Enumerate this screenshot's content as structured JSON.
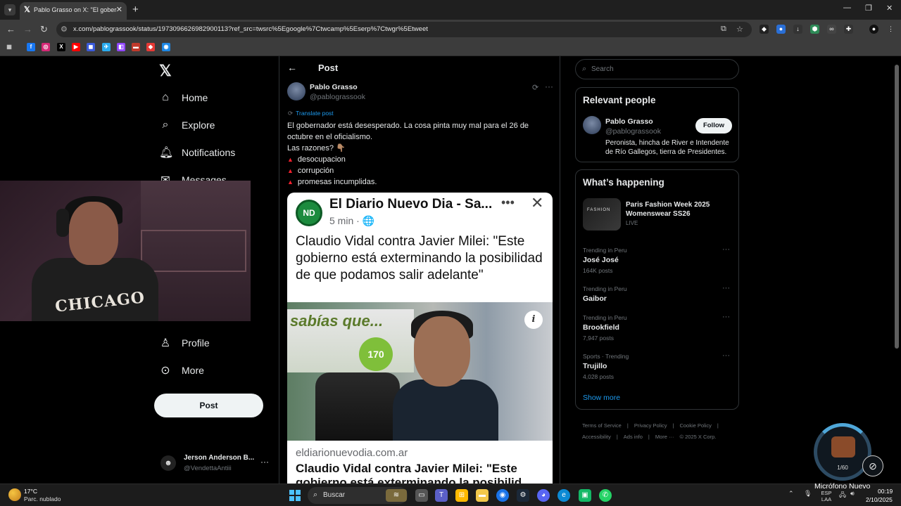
{
  "browser": {
    "tab_title": "Pablo Grasso on X: \"El gobernador...",
    "url": "x.com/pablograssook/status/1973096626982900113?ref_src=twsrc%5Egoogle%7Ctwcamp%5Eserp%7Ctwgr%5Etweet"
  },
  "nav": {
    "items": [
      {
        "label": "Home"
      },
      {
        "label": "Explore"
      },
      {
        "label": "Notifications"
      },
      {
        "label": "Messages"
      },
      {
        "label": "Profile"
      },
      {
        "label": "More"
      }
    ],
    "post_button": "Post"
  },
  "account": {
    "name": "Jerson Anderson B...",
    "handle": "@VendettaAntiii"
  },
  "webcam": {
    "shirt_text": "CHICAGO"
  },
  "post": {
    "header": "Post",
    "author_name": "Pablo Grasso",
    "author_handle": "@pablograssook",
    "translate": "Translate post",
    "line1": "El gobernador está desesperado. La cosa pinta muy mal para el 26 de octubre en el oficialismo.",
    "line2": "Las razones? 👇🏽",
    "bullets": [
      "desocupacion",
      "corrupción",
      "promesas incumplidas."
    ],
    "card": {
      "logo": "ND",
      "source": "El Diario Nuevo Dia - Sa...",
      "time": "5 min · 🌐",
      "headline": "Claudio Vidal contra Javier Milei: \"Este gobierno está exterminando la posibilidad de que podamos salir adelante\"",
      "billboard": "sabías que...",
      "badge": "170",
      "domain": "eldiarionuevodia.com.ar",
      "headline2": "Claudio Vidal contra Javier Milei: \"Este gobierno está exterminando la posibilid..."
    }
  },
  "sidebar": {
    "search_placeholder": "Search",
    "relevant_title": "Relevant people",
    "rp_name": "Pablo Grasso",
    "rp_handle": "@pablograssook",
    "follow": "Follow",
    "rp_bio": "Peronista, hincha de River e Intendente de Río Gallegos, tierra de Presidentes.",
    "happening_title": "What’s happening",
    "event_thumb": "FASHION",
    "event_title": "Paris Fashion Week 2025 Womenswear SS26",
    "event_live": "LIVE",
    "trends": [
      {
        "context": "Trending in Peru",
        "name": "José José",
        "count": "164K posts"
      },
      {
        "context": "Trending in Peru",
        "name": "Gaibor",
        "count": ""
      },
      {
        "context": "Trending in Peru",
        "name": "Brookfield",
        "count": "7,947 posts"
      },
      {
        "context": "Sports · Trending",
        "name": "Trujillo",
        "count": "4,028 posts"
      }
    ],
    "show_more": "Show more",
    "footer": [
      "Terms of Service",
      "|",
      "Privacy Policy",
      "|",
      "Cookie Policy",
      "|",
      "Accessibility",
      "|",
      "Ads info",
      "|",
      "More ···",
      "© 2025 X Corp."
    ]
  },
  "widget": {
    "count": "1/60"
  },
  "taskbar": {
    "temp": "17°C",
    "weather": "Parc. nublado",
    "search": "Buscar",
    "lang": "ESP LAA",
    "mic_label": "Micrófono Nuevo",
    "time": "00:19",
    "date": "2/10/2025"
  }
}
